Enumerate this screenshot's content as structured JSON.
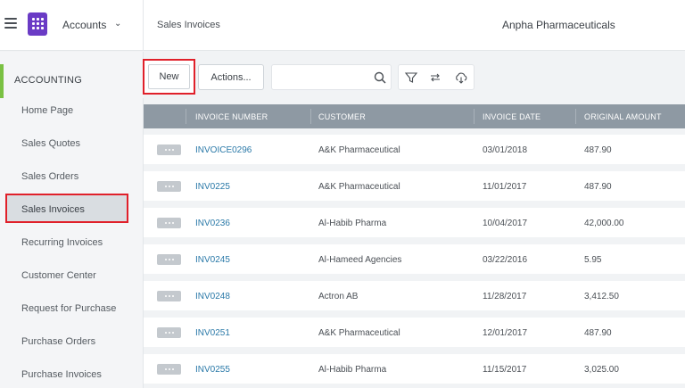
{
  "app": {
    "name": "Accounts",
    "company": "Anpha Pharmaceuticals",
    "breadcrumb": "Sales Invoices"
  },
  "sidebar": {
    "section": "ACCOUNTING",
    "items": [
      {
        "label": "Home Page"
      },
      {
        "label": "Sales Quotes"
      },
      {
        "label": "Sales Orders"
      },
      {
        "label": "Sales Invoices",
        "active": true
      },
      {
        "label": "Recurring Invoices"
      },
      {
        "label": "Customer Center"
      },
      {
        "label": "Request for Purchase"
      },
      {
        "label": "Purchase Orders"
      },
      {
        "label": "Purchase Invoices"
      }
    ]
  },
  "toolbar": {
    "new_label": "New",
    "actions_label": "Actions...",
    "search_value": "",
    "search_placeholder": ""
  },
  "table": {
    "columns": [
      "INVOICE NUMBER",
      "CUSTOMER",
      "INVOICE DATE",
      "ORIGINAL AMOUNT"
    ],
    "rows": [
      {
        "number": "INVOICE0296",
        "customer": "A&K Pharmaceutical",
        "date": "03/01/2018",
        "amount": "487.90"
      },
      {
        "number": "INV0225",
        "customer": "A&K Pharmaceutical",
        "date": "11/01/2017",
        "amount": "487.90"
      },
      {
        "number": "INV0236",
        "customer": "Al-Habib Pharma",
        "date": "10/04/2017",
        "amount": "42,000.00"
      },
      {
        "number": "INV0245",
        "customer": "Al-Hameed Agencies",
        "date": "03/22/2016",
        "amount": "5.95"
      },
      {
        "number": "INV0248",
        "customer": "Actron AB",
        "date": "11/28/2017",
        "amount": "3,412.50"
      },
      {
        "number": "INV0251",
        "customer": "A&K Pharmaceutical",
        "date": "12/01/2017",
        "amount": "487.90"
      },
      {
        "number": "INV0255",
        "customer": "Al-Habib Pharma",
        "date": "11/15/2017",
        "amount": "3,025.00"
      }
    ]
  },
  "colors": {
    "accent_green": "#7ac143",
    "highlight_red": "#e0202a",
    "logo_purple": "#6a3bc5",
    "link_blue": "#2a79a8",
    "header_gray": "#8e99a3"
  }
}
